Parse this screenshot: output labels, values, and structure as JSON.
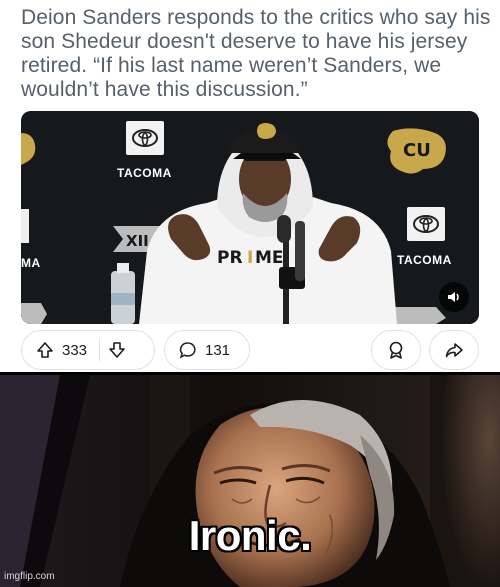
{
  "post": {
    "headline": "Deion Sanders responds to the critics who say his son Shedeur doesn't deserve to have his jersey retired. “If his last name weren’t Sanders, we wouldn’t have this discussion.”",
    "video": {
      "sponsor_labels": [
        "TACOMA",
        "TACOMA",
        "MA"
      ],
      "volume_icon": "volume-icon"
    },
    "actions": {
      "upvote_count": "333",
      "comment_count": "131",
      "icons": {
        "upvote": "upvote-arrow-icon",
        "downvote": "downvote-arrow-icon",
        "comment": "comment-bubble-icon",
        "award": "award-icon",
        "share": "share-arrow-icon"
      }
    }
  },
  "meme": {
    "caption": "Ironic.",
    "watermark": "imgflip.com"
  },
  "colors": {
    "headline": "#56616b",
    "pill_border": "#dfe2e5",
    "backdrop": "#151718",
    "caption": "#ffffff"
  }
}
